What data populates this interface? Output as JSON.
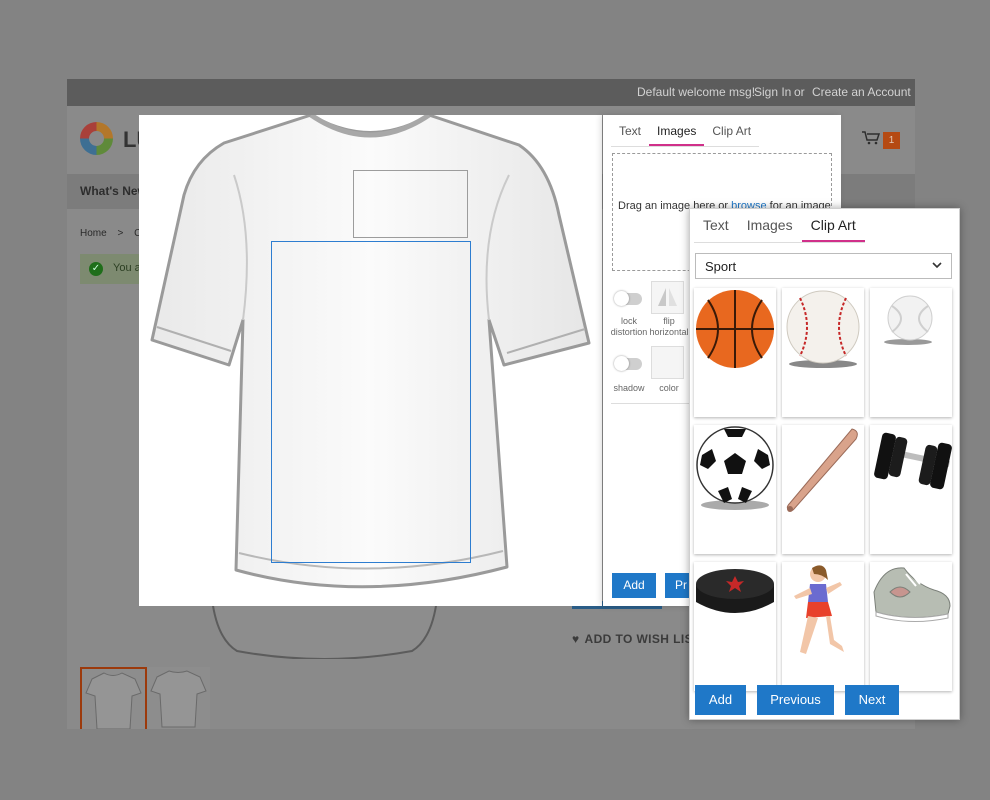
{
  "store": {
    "welcome": "Default welcome msg!",
    "sign_in": "Sign In",
    "or": "or",
    "create_account": "Create an Account",
    "logo_text": "LU",
    "nav_whats_new": "What's New",
    "breadcrumb_home": "Home",
    "breadcrumb_sep": ">",
    "breadcrumb_next": "C",
    "success_msg": "You a",
    "cart_count": "1",
    "wishlist": "ADD TO WISH LIST"
  },
  "images_panel": {
    "tabs": [
      "Text",
      "Images",
      "Clip Art"
    ],
    "active_tab": "Images",
    "drop_prefix": "Drag an image here or ",
    "drop_link": "browse",
    "drop_suffix": " for an image",
    "opt_lock_1": "lock",
    "opt_lock_2": "distortion",
    "opt_flip_1": "flip",
    "opt_flip_2": "horizontal",
    "opt_shadow": "shadow",
    "opt_color": "color",
    "add_label": "Add",
    "preview_label": "Pr"
  },
  "clipart_panel": {
    "tabs": [
      "Text",
      "Images",
      "Clip Art"
    ],
    "active_tab": "Clip Art",
    "category": "Sport",
    "items": [
      {
        "icon": "basketball-icon"
      },
      {
        "icon": "baseball-icon"
      },
      {
        "icon": "tennis-ball-icon"
      },
      {
        "icon": "soccer-ball-icon"
      },
      {
        "icon": "baseball-bat-icon"
      },
      {
        "icon": "dumbbell-icon"
      },
      {
        "icon": "hockey-puck-icon"
      },
      {
        "icon": "runner-icon"
      },
      {
        "icon": "sneaker-icon"
      }
    ],
    "buttons": {
      "add": "Add",
      "previous": "Previous",
      "next": "Next"
    }
  },
  "colors": {
    "accent_blue": "#1f78c8",
    "tab_underline": "#d0308a",
    "cart_badge": "#b54a13"
  }
}
